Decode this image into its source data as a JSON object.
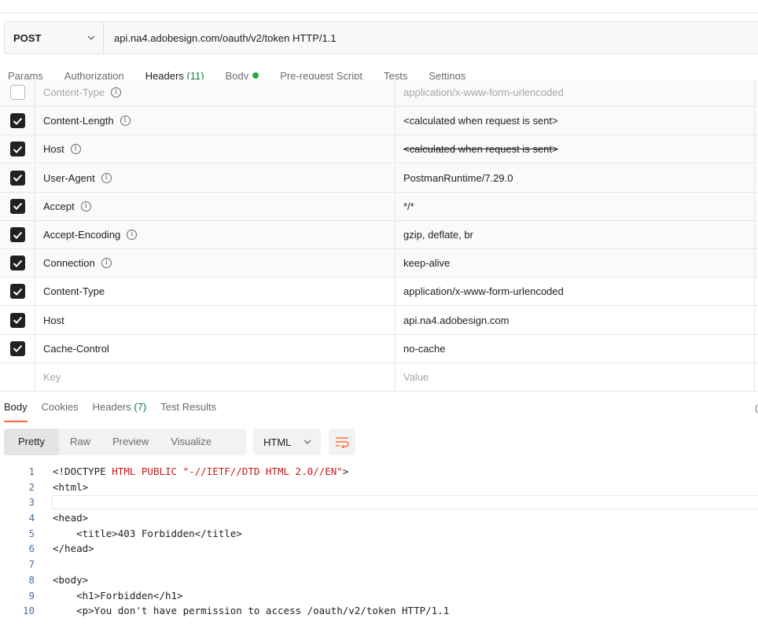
{
  "request": {
    "method": "POST",
    "url": "api.na4.adobesign.com/oauth/v2/token HTTP/1.1"
  },
  "request_tabs": [
    {
      "label": "Params",
      "count": ""
    },
    {
      "label": "Authorization",
      "count": ""
    },
    {
      "label": "Headers",
      "count": "(11)"
    },
    {
      "label": "Body",
      "count": ""
    },
    {
      "label": "Pre-request Script",
      "count": ""
    },
    {
      "label": "Tests",
      "count": ""
    },
    {
      "label": "Settings",
      "count": ""
    }
  ],
  "headers": [
    {
      "key": "Content-Type",
      "value": "application/x-www-form-urlencoded",
      "checked": false,
      "info": true,
      "auto": true,
      "strike": false
    },
    {
      "key": "Content-Length",
      "value": "<calculated when request is sent>",
      "checked": true,
      "info": true,
      "auto": true,
      "strike": false
    },
    {
      "key": "Host",
      "value": "<calculated when request is sent>",
      "checked": true,
      "info": true,
      "auto": true,
      "strike": true
    },
    {
      "key": "User-Agent",
      "value": "PostmanRuntime/7.29.0",
      "checked": true,
      "info": true,
      "auto": true,
      "strike": false
    },
    {
      "key": "Accept",
      "value": "*/*",
      "checked": true,
      "info": true,
      "auto": true,
      "strike": false
    },
    {
      "key": "Accept-Encoding",
      "value": "gzip, deflate, br",
      "checked": true,
      "info": true,
      "auto": true,
      "strike": false
    },
    {
      "key": "Connection",
      "value": "keep-alive",
      "checked": true,
      "info": true,
      "auto": true,
      "strike": false
    },
    {
      "key": "Content-Type",
      "value": "application/x-www-form-urlencoded",
      "checked": true,
      "info": false,
      "auto": false,
      "strike": false
    },
    {
      "key": "Host",
      "value": "api.na4.adobesign.com",
      "checked": true,
      "info": false,
      "auto": false,
      "strike": false
    },
    {
      "key": "Cache-Control",
      "value": "no-cache",
      "checked": true,
      "info": false,
      "auto": false,
      "strike": false
    }
  ],
  "new_row": {
    "key_placeholder": "Key",
    "value_placeholder": "Value"
  },
  "response_tabs": [
    {
      "label": "Body",
      "count": ""
    },
    {
      "label": "Cookies",
      "count": ""
    },
    {
      "label": "Headers",
      "count": "(7)"
    },
    {
      "label": "Test Results",
      "count": ""
    }
  ],
  "edge_mark": "(",
  "view_modes": [
    "Pretty",
    "Raw",
    "Preview",
    "Visualize"
  ],
  "language": "HTML",
  "code_lines": [
    {
      "n": "1",
      "text": "<!DOCTYPE HTML PUBLIC \"-//IETF//DTD HTML 2.0//EN\">"
    },
    {
      "n": "2",
      "text": "<html>"
    },
    {
      "n": "3",
      "text": ""
    },
    {
      "n": "4",
      "text": "<head>"
    },
    {
      "n": "5",
      "text": "    <title>403 Forbidden</title>"
    },
    {
      "n": "6",
      "text": "</head>"
    },
    {
      "n": "7",
      "text": ""
    },
    {
      "n": "8",
      "text": "<body>"
    },
    {
      "n": "9",
      "text": "    <h1>Forbidden</h1>"
    },
    {
      "n": "10",
      "text": "    <p>You don't have permission to access /oauth/v2/token HTTP/1.1"
    }
  ],
  "colors": {
    "accent": "#ff6c37",
    "count_green": "#0f7a3f",
    "dot_green": "#28a745"
  }
}
